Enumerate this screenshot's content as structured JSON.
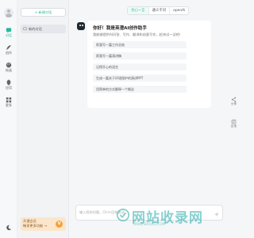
{
  "nav": {
    "items": [
      {
        "label": "对话",
        "icon": "chat-icon",
        "active": true
      },
      {
        "label": "创作",
        "icon": "feather-icon",
        "active": false
      },
      {
        "label": "绘画",
        "icon": "palette-icon",
        "active": false
      },
      {
        "label": "应用",
        "icon": "leaf-icon",
        "active": false
      },
      {
        "label": "更多",
        "icon": "grid-icon",
        "active": false
      }
    ],
    "theme_icon": "moon-icon"
  },
  "sidebar": {
    "new_chat_label": "+ 新建对话",
    "conversations": [
      {
        "title": "新的对话"
      }
    ],
    "login_line1": "开通会员",
    "login_line2": "畅享更多功能 →",
    "login_badge": "V"
  },
  "main": {
    "tabs": [
      {
        "label": "文心一言",
        "active": true
      },
      {
        "label": "通义千问",
        "active": false
      },
      {
        "label": "openAi",
        "active": false
      }
    ],
    "greeting": {
      "title": "你好！我是英澄AI创作助手",
      "subtitle": "我能够提供AI问答、写作、翻译和创意写作，赶快试一试吧！"
    },
    "suggestions": [
      "帮我写一篇工作总结",
      "帮我写一篇演讲稿",
      "记得开心的语言",
      "生成一篇关于环境保护的演讲PPT",
      "用简单的方式解释一个概念"
    ],
    "input_placeholder": "输入您的问题，Ctrl+回车发送"
  },
  "right_tools": [
    {
      "label": "分享",
      "icon": "share-icon"
    },
    {
      "label": "反馈",
      "icon": "feedback-icon"
    }
  ],
  "watermark": {
    "text": "网站收录网",
    "sub": "WWW.SHOULU.COM"
  },
  "colors": {
    "accent": "#2ab89b",
    "login_bg": "#fbe6cc",
    "login_badge": "#f5a23a"
  }
}
